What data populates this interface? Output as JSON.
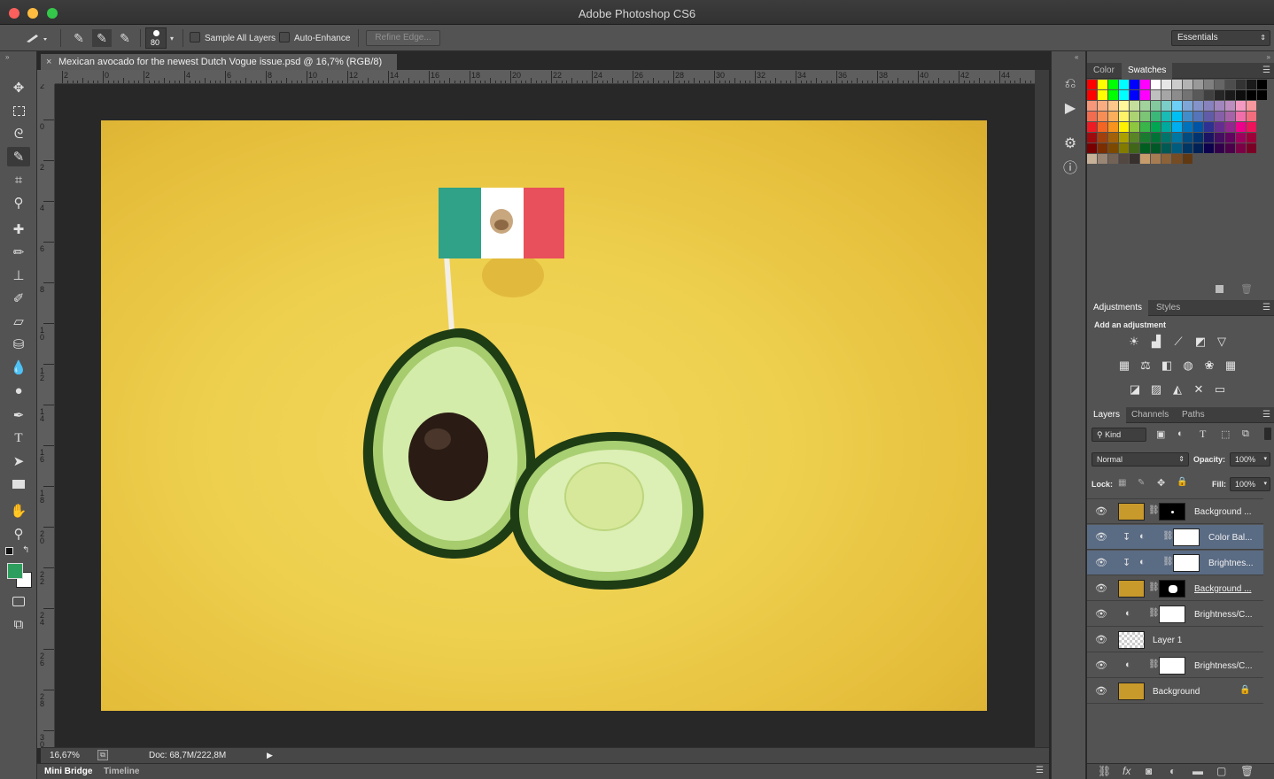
{
  "app": {
    "title": "Adobe Photoshop CS6"
  },
  "options": {
    "brush_size": "80",
    "sample_all_layers": "Sample All Layers",
    "auto_enhance": "Auto-Enhance",
    "refine_edge": "Refine Edge...",
    "workspace": "Essentials"
  },
  "document": {
    "tab_title": "Mexican avocado for the newest Dutch Vogue issue.psd @ 16,7% (RGB/8)",
    "zoom": "16,67%",
    "doc_size": "Doc: 68,7M/222,8M"
  },
  "rulers": {
    "top": [
      "2",
      "0",
      "2",
      "4",
      "6",
      "8",
      "10",
      "12",
      "14",
      "16",
      "18",
      "20",
      "22",
      "24",
      "26",
      "28",
      "30",
      "32",
      "34",
      "36",
      "38",
      "40",
      "42",
      "44"
    ],
    "left": [
      "2",
      "0",
      "2",
      "4",
      "6",
      "8",
      "1\n0",
      "1\n2",
      "1\n4",
      "1\n6",
      "1\n8",
      "2\n0",
      "2\n2",
      "2\n4",
      "2\n6",
      "2\n8",
      "3\n0"
    ]
  },
  "bottom_tabs": {
    "mini_bridge": "Mini Bridge",
    "timeline": "Timeline"
  },
  "panels": {
    "color_tabs": {
      "color": "Color",
      "swatches": "Swatches"
    },
    "adjust_tabs": {
      "adjustments": "Adjustments",
      "styles": "Styles"
    },
    "add_adjustment": "Add an adjustment",
    "layer_tabs": {
      "layers": "Layers",
      "channels": "Channels",
      "paths": "Paths"
    },
    "kind": "Kind",
    "blend_mode": "Normal",
    "opacity_label": "Opacity:",
    "opacity": "100%",
    "lock_label": "Lock:",
    "fill_label": "Fill:",
    "fill": "100%"
  },
  "layers": [
    {
      "name": "Background ...",
      "type": "image-mask-black"
    },
    {
      "name": "Color Bal...",
      "type": "adjust-clipped"
    },
    {
      "name": "Brightnes...",
      "type": "adjust-clipped"
    },
    {
      "name": "Background ...",
      "type": "image-mask-shape"
    },
    {
      "name": "Brightness/C...",
      "type": "adjust"
    },
    {
      "name": "Layer 1",
      "type": "transparent"
    },
    {
      "name": "Brightness/C...",
      "type": "adjust"
    },
    {
      "name": "Background",
      "type": "background-locked"
    }
  ],
  "colors": {
    "foreground": "#2e9e5e",
    "background": "#ffffff",
    "selected_layer": "#5a6b84",
    "photo_yellow": "#efd150"
  },
  "swatches": {
    "row0": [
      "#ff0000",
      "#ffff00",
      "#00ff00",
      "#00ffff",
      "#0000ff",
      "#ff00ff",
      "#ffffff",
      "#e6e6e6",
      "#cccccc",
      "#b3b3b3",
      "#999999",
      "#808080",
      "#666666",
      "#4d4d4d",
      "#333333",
      "#1a1a1a",
      "#000000"
    ],
    "row1": [
      "#ff0000",
      "#ffff00",
      "#00ff00",
      "#00ffff",
      "#0000ff",
      "#ff00ff",
      "#bfbfbf",
      "#a6a6a6",
      "#8c8c8c",
      "#737373",
      "#595959",
      "#404040",
      "#262626",
      "#1a1a1a",
      "#0d0d0d",
      "#000000",
      "#000000"
    ],
    "row2": [
      "#f7977a",
      "#f9ad81",
      "#fdc68a",
      "#fff79a",
      "#c4df9b",
      "#a2d39c",
      "#82ca9d",
      "#7bcdc8",
      "#6ecff6",
      "#7ea7d8",
      "#8493ca",
      "#8882be",
      "#a187be",
      "#bc8dbf",
      "#f49ac2",
      "#f6989d"
    ],
    "row3": [
      "#f26c4f",
      "#f68e55",
      "#fbaf5c",
      "#fff467",
      "#acd372",
      "#7cc576",
      "#3bb878",
      "#1abbb4",
      "#00bff3",
      "#438cca",
      "#5574b9",
      "#605ca8",
      "#855fa8",
      "#a763a8",
      "#f06ea9",
      "#f26d7d"
    ],
    "row4": [
      "#ed1c24",
      "#f26522",
      "#f7941d",
      "#fff200",
      "#8dc63f",
      "#39b54a",
      "#00a651",
      "#00a99d",
      "#00aeef",
      "#0072bc",
      "#0054a6",
      "#2e3192",
      "#662d91",
      "#92278f",
      "#ec008c",
      "#ed145b"
    ],
    "row5": [
      "#9e0b0f",
      "#a0410d",
      "#a36209",
      "#aba000",
      "#598527",
      "#1a7b30",
      "#007236",
      "#00746b",
      "#0076a3",
      "#004b80",
      "#003471",
      "#1b1464",
      "#440e62",
      "#630460",
      "#9e005d",
      "#9e0039"
    ],
    "row6": [
      "#790000",
      "#7b2e00",
      "#7d4900",
      "#827b00",
      "#406618",
      "#005e20",
      "#005826",
      "#005952",
      "#005b7f",
      "#003663",
      "#002157",
      "#0d004c",
      "#32004b",
      "#4b0049",
      "#7b0046",
      "#7a0026"
    ],
    "row7": [
      "#c7b299",
      "#998675",
      "#736357",
      "#534741",
      "#37302d",
      "#c69c6d",
      "#a67c52",
      "#8c6239",
      "#754c24",
      "#603913"
    ]
  }
}
